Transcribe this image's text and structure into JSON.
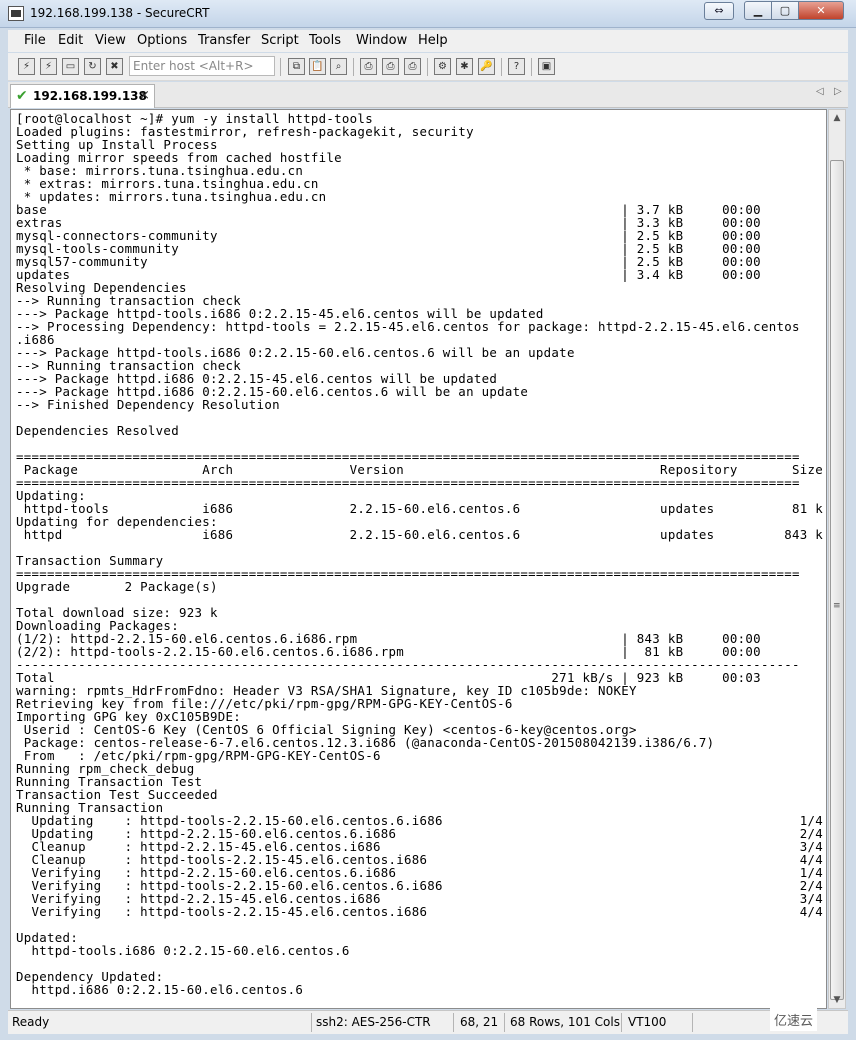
{
  "window": {
    "title": "192.168.199.138 - SecureCRT"
  },
  "menu": [
    "File",
    "Edit",
    "View",
    "Options",
    "Transfer",
    "Script",
    "Tools",
    "Window",
    "Help"
  ],
  "toolbar": {
    "host_placeholder": "Enter host <Alt+R>"
  },
  "tab": {
    "label": "192.168.199.138",
    "close": "×"
  },
  "terminal_lines": [
    "[root@localhost ~]# yum -y install httpd-tools",
    "Loaded plugins: fastestmirror, refresh-packagekit, security",
    "Setting up Install Process",
    "Loading mirror speeds from cached hostfile",
    " * base: mirrors.tuna.tsinghua.edu.cn",
    " * extras: mirrors.tuna.tsinghua.edu.cn",
    " * updates: mirrors.tuna.tsinghua.edu.cn",
    "base                                                                          | 3.7 kB     00:00",
    "extras                                                                        | 3.3 kB     00:00",
    "mysql-connectors-community                                                    | 2.5 kB     00:00",
    "mysql-tools-community                                                         | 2.5 kB     00:00",
    "mysql57-community                                                             | 2.5 kB     00:00",
    "updates                                                                       | 3.4 kB     00:00",
    "Resolving Dependencies",
    "--> Running transaction check",
    "---> Package httpd-tools.i686 0:2.2.15-45.el6.centos will be updated",
    "--> Processing Dependency: httpd-tools = 2.2.15-45.el6.centos for package: httpd-2.2.15-45.el6.centos",
    ".i686",
    "---> Package httpd-tools.i686 0:2.2.15-60.el6.centos.6 will be an update",
    "--> Running transaction check",
    "---> Package httpd.i686 0:2.2.15-45.el6.centos will be updated",
    "---> Package httpd.i686 0:2.2.15-60.el6.centos.6 will be an update",
    "--> Finished Dependency Resolution",
    "",
    "Dependencies Resolved",
    "",
    "=====================================================================================================",
    " Package                Arch               Version                                 Repository       Size",
    "=====================================================================================================",
    "Updating:",
    " httpd-tools            i686               2.2.15-60.el6.centos.6                  updates          81 k",
    "Updating for dependencies:",
    " httpd                  i686               2.2.15-60.el6.centos.6                  updates         843 k",
    "",
    "Transaction Summary",
    "=====================================================================================================",
    "Upgrade       2 Package(s)",
    "",
    "Total download size: 923 k",
    "Downloading Packages:",
    "(1/2): httpd-2.2.15-60.el6.centos.6.i686.rpm                                  | 843 kB     00:00",
    "(2/2): httpd-tools-2.2.15-60.el6.centos.6.i686.rpm                            |  81 kB     00:00",
    "-----------------------------------------------------------------------------------------------------",
    "Total                                                                271 kB/s | 923 kB     00:03",
    "warning: rpmts_HdrFromFdno: Header V3 RSA/SHA1 Signature, key ID c105b9de: NOKEY",
    "Retrieving key from file:///etc/pki/rpm-gpg/RPM-GPG-KEY-CentOS-6",
    "Importing GPG key 0xC105B9DE:",
    " Userid : CentOS-6 Key (CentOS 6 Official Signing Key) <centos-6-key@centos.org>",
    " Package: centos-release-6-7.el6.centos.12.3.i686 (@anaconda-CentOS-201508042139.i386/6.7)",
    " From   : /etc/pki/rpm-gpg/RPM-GPG-KEY-CentOS-6",
    "Running rpm_check_debug",
    "Running Transaction Test",
    "Transaction Test Succeeded",
    "Running Transaction",
    "  Updating    : httpd-tools-2.2.15-60.el6.centos.6.i686                                              1/4",
    "  Updating    : httpd-2.2.15-60.el6.centos.6.i686                                                    2/4",
    "  Cleanup     : httpd-2.2.15-45.el6.centos.i686                                                      3/4",
    "  Cleanup     : httpd-tools-2.2.15-45.el6.centos.i686                                                4/4",
    "  Verifying   : httpd-2.2.15-60.el6.centos.6.i686                                                    1/4",
    "  Verifying   : httpd-tools-2.2.15-60.el6.centos.6.i686                                              2/4",
    "  Verifying   : httpd-2.2.15-45.el6.centos.i686                                                      3/4",
    "  Verifying   : httpd-tools-2.2.15-45.el6.centos.i686                                                4/4",
    "",
    "Updated:",
    "  httpd-tools.i686 0:2.2.15-60.el6.centos.6",
    "",
    "Dependency Updated:",
    "  httpd.i686 0:2.2.15-60.el6.centos.6"
  ],
  "status": {
    "ready": "Ready",
    "cipher": "ssh2: AES-256-CTR",
    "cursor": "68,  21",
    "size": "68 Rows, 101 Cols",
    "emulation": "VT100"
  },
  "watermark": "亿速云",
  "colors": {
    "close_button": "#c0432c",
    "tab_check": "#3aa030"
  }
}
